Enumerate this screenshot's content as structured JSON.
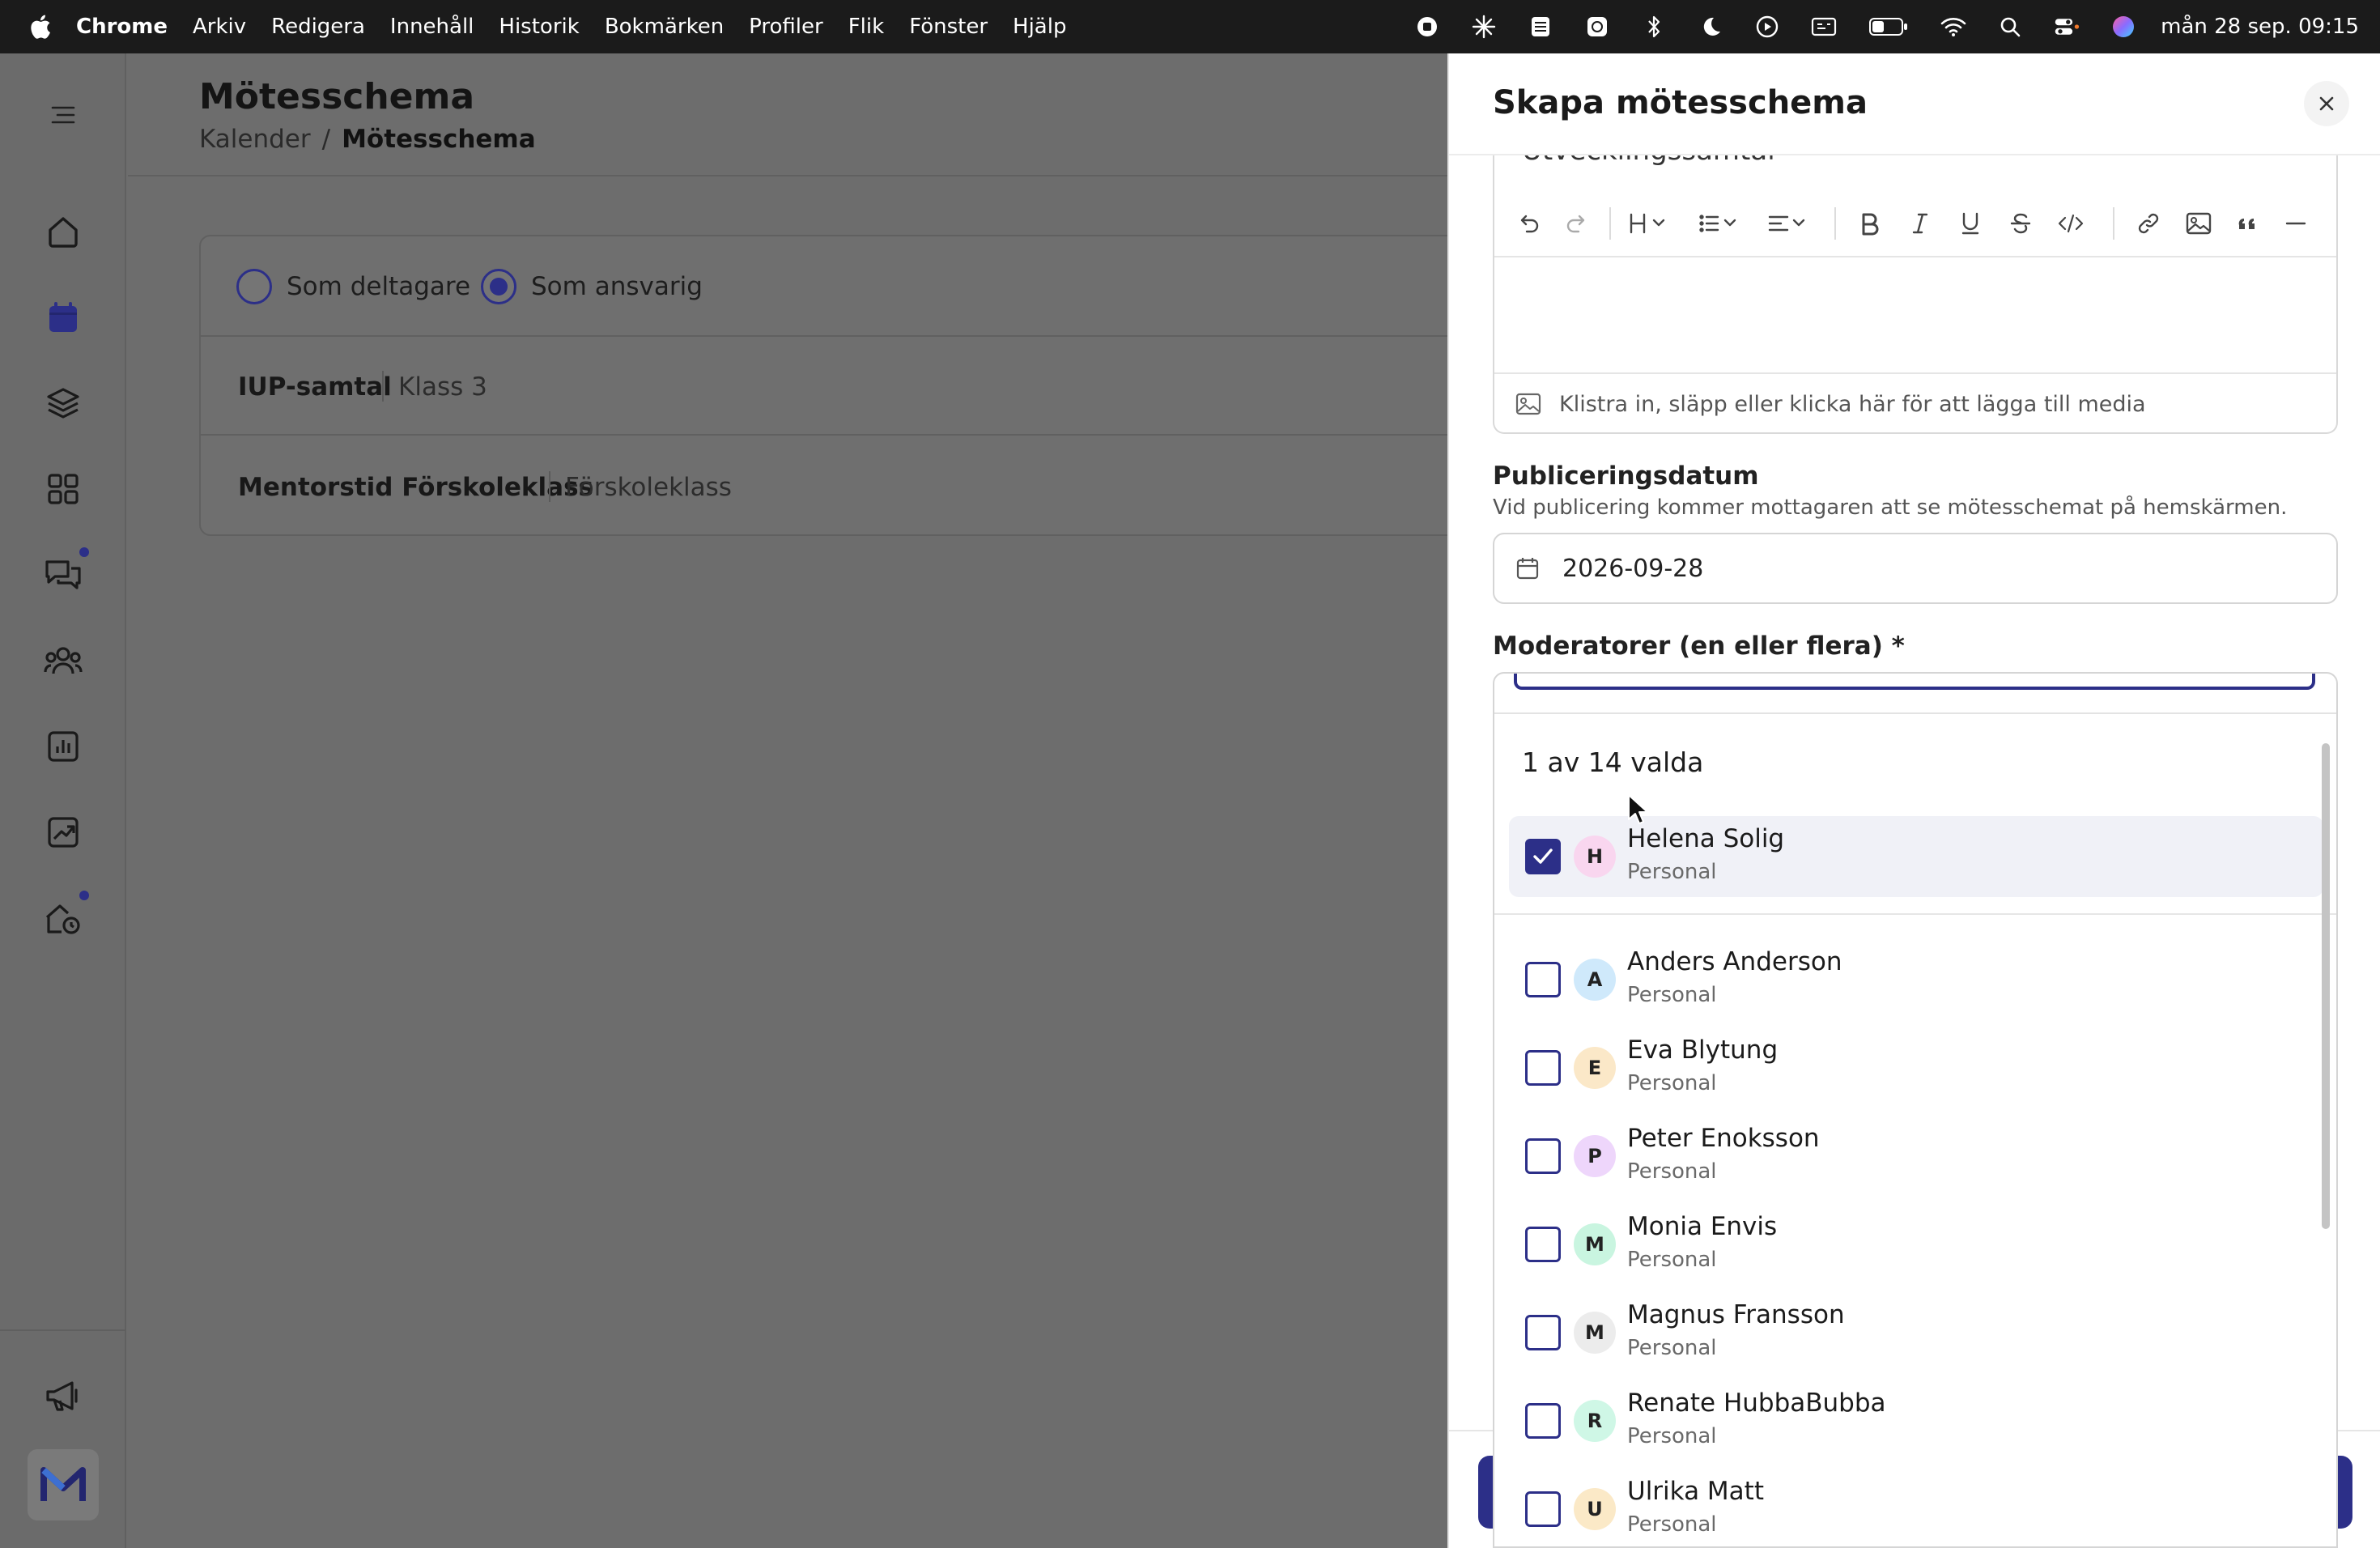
{
  "menubar": {
    "app_name": "Chrome",
    "items": [
      "Arkiv",
      "Redigera",
      "Innehåll",
      "Historik",
      "Bokmärken",
      "Profiler",
      "Flik",
      "Fönster",
      "Hjälp"
    ],
    "clock": "mån 28 sep. 09:15",
    "status_icons": [
      "record-icon",
      "asterisk-icon",
      "stack-icon",
      "app-icon",
      "bluetooth-icon",
      "moon-icon",
      "play-icon",
      "display-icon",
      "battery-icon",
      "wifi-icon",
      "search-icon",
      "control-center-icon",
      "siri-icon"
    ]
  },
  "app": {
    "page_title": "Mötesschema",
    "breadcrumb": {
      "parent": "Kalender",
      "separator": "/",
      "current": "Mötesschema"
    },
    "role_filter": {
      "option_participant": "Som deltagare",
      "option_responsible": "Som ansvarig",
      "selected": "Som ansvarig"
    },
    "schedules": [
      {
        "name": "IUP-samtal",
        "group": "Klass 3"
      },
      {
        "name": "Mentorstid Förskoleklass",
        "group": "Förskoleklass"
      }
    ],
    "nav_icons": [
      "menu-icon",
      "home-icon",
      "calendar-icon",
      "layers-icon",
      "apps-icon",
      "chat-icon",
      "people-icon",
      "chart-icon",
      "trend-icon",
      "house-icon",
      "megaphone-icon",
      "brand-logo"
    ]
  },
  "drawer": {
    "title": "Skapa mötesschema",
    "partial_title_text": "Utvecklingssamtal",
    "editor_media_hint": "Klistra in, släpp eller klicka här för att lägga till media",
    "publish_label": "Publiceringsdatum",
    "publish_help": "Vid publicering kommer mottagaren att se mötesschemat på hemskärmen.",
    "publish_date": "2026-09-28",
    "moderators_label": "Moderatorer (en eller flera) *",
    "moderators_count": "1 av 14 valda",
    "selected": [
      {
        "name": "Helena Solig",
        "role": "Personal",
        "initial": "H",
        "color": "#f9d6ef"
      }
    ],
    "options": [
      {
        "name": "Anders Anderson",
        "role": "Personal",
        "initial": "A",
        "color": "#cfe9fb"
      },
      {
        "name": "Eva Blytung",
        "role": "Personal",
        "initial": "E",
        "color": "#fbe8c8"
      },
      {
        "name": "Peter Enoksson",
        "role": "Personal",
        "initial": "P",
        "color": "#eed6fb"
      },
      {
        "name": "Monia Envis",
        "role": "Personal",
        "initial": "M",
        "color": "#c9f5e0"
      },
      {
        "name": "Magnus Fransson",
        "role": "Personal",
        "initial": "M",
        "color": "#ececec"
      },
      {
        "name": "Renate HubbaBubba",
        "role": "Personal",
        "initial": "R",
        "color": "#cff7e6"
      },
      {
        "name": "Ulrika Matt",
        "role": "Personal",
        "initial": "U",
        "color": "#fbe9c7"
      }
    ]
  },
  "colors": {
    "accent": "#2c2f88",
    "overlay": "#6f6f6f",
    "menubar": "#1b1b1b"
  }
}
